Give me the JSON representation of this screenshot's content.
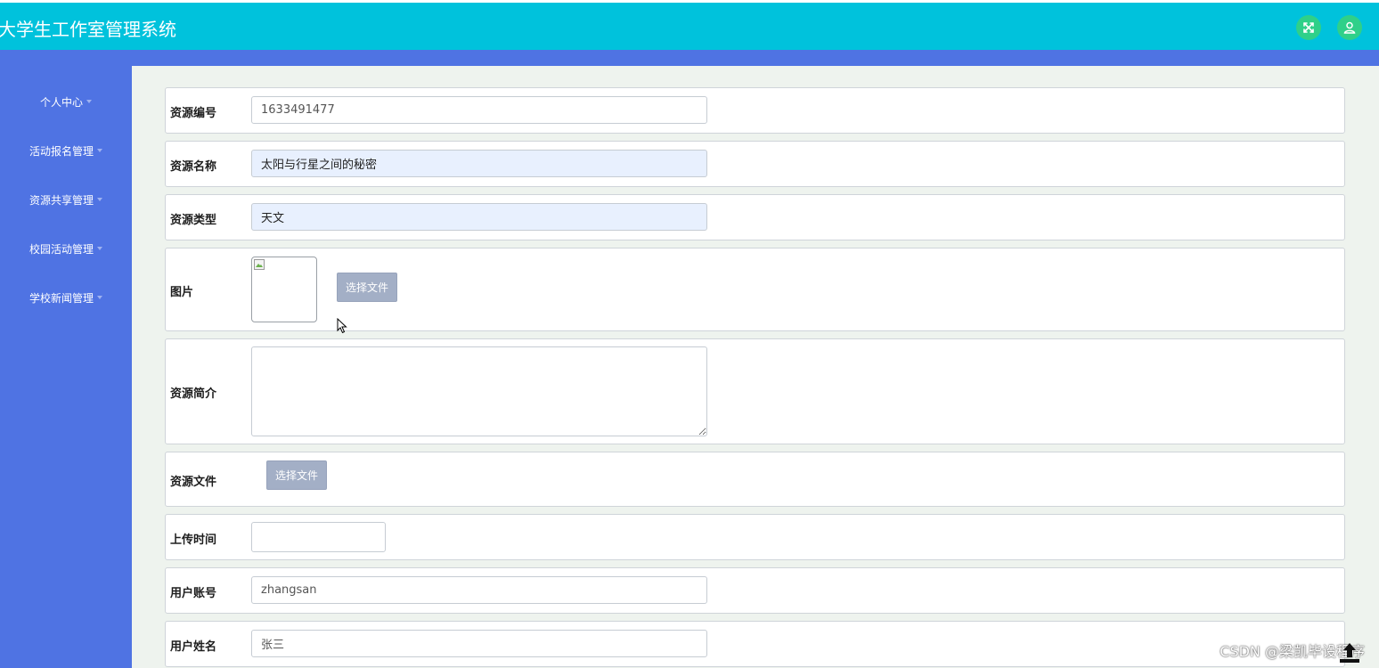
{
  "app": {
    "title": "大学生工作室管理系统"
  },
  "header": {
    "icons": [
      {
        "name": "fullscreen-icon"
      },
      {
        "name": "user-icon"
      }
    ],
    "accent_color": "#00c2dc",
    "button_color": "#2fd089"
  },
  "sidebar": {
    "background": "#4f73e3",
    "items": [
      {
        "label": "个人中心"
      },
      {
        "label": "活动报名管理"
      },
      {
        "label": "资源共享管理"
      },
      {
        "label": "校园活动管理"
      },
      {
        "label": "学校新闻管理"
      }
    ]
  },
  "form": {
    "resource_no": {
      "label": "资源编号",
      "value": "1633491477"
    },
    "resource_name": {
      "label": "资源名称",
      "value": "太阳与行星之间的秘密"
    },
    "resource_type": {
      "label": "资源类型",
      "value": "天文"
    },
    "image": {
      "label": "图片",
      "button": "选择文件"
    },
    "intro": {
      "label": "资源简介",
      "value": ""
    },
    "file": {
      "label": "资源文件",
      "button": "选择文件"
    },
    "upload_time": {
      "label": "上传时间",
      "value": ""
    },
    "user_account": {
      "label": "用户账号",
      "value": "zhangsan"
    },
    "user_name": {
      "label": "用户姓名",
      "value": "张三"
    }
  },
  "watermark": {
    "text": "CSDN @梁凯毕设程序"
  }
}
